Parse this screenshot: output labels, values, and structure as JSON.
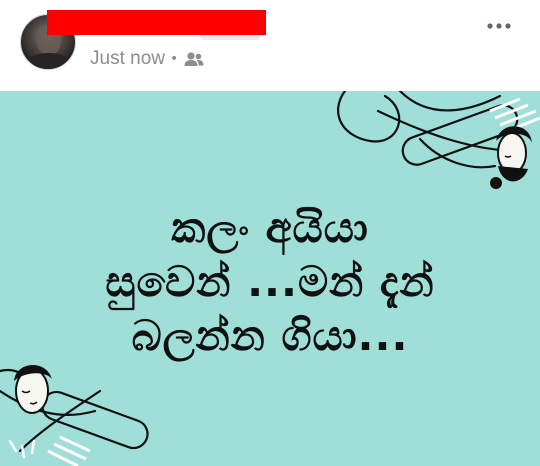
{
  "post": {
    "author": {
      "name": ""
    },
    "timestamp": "Just now",
    "separator": "•",
    "audience_icon": "friends-icon",
    "more_icon": "more-horizontal-icon"
  },
  "image": {
    "background": "#9fdfd8",
    "caption_lines": [
      "කලං අයියා",
      "සුවෙන් ...මන් දැන්",
      "බලන්න ගියා..."
    ]
  },
  "colors": {
    "redaction": "#ff0000",
    "meta_text": "#8a8d91",
    "caption_text": "#111111"
  }
}
